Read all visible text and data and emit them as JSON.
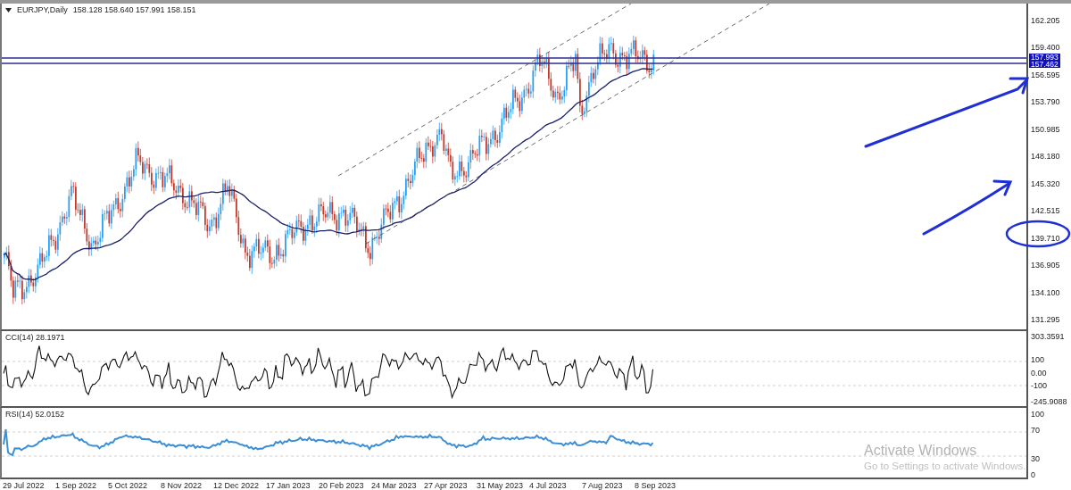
{
  "main_chart": {
    "symbol": "EURJPY,Daily",
    "ohlc": "158.128 158.640 157.991 158.151",
    "price_axis": [
      "162.205",
      "159.400",
      "156.595",
      "153.790",
      "150.985",
      "148.180",
      "145.320",
      "142.515",
      "139.710",
      "136.905",
      "134.100",
      "131.295"
    ],
    "price_lines": [
      {
        "label": "157.993"
      },
      {
        "label": "157.462"
      }
    ]
  },
  "cci": {
    "title": "CCI(14) 28.1971",
    "axis": [
      "303.3591",
      "100",
      "0.00",
      "-100",
      "-245.9088"
    ]
  },
  "rsi": {
    "title": "RSI(14) 52.0152",
    "axis": [
      "100",
      "70",
      "30",
      "0"
    ]
  },
  "time_axis": [
    "29 Jul 2022",
    "1 Sep 2022",
    "5 Oct 2022",
    "8 Nov 2022",
    "12 Dec 2022",
    "17 Jan 2023",
    "20 Feb 2023",
    "24 Mar 2023",
    "27 Apr 2023",
    "31 May 2023",
    "4 Jul 2023",
    "7 Aug 2023",
    "8 Sep 2023"
  ],
  "os_notice": {
    "title": "Activate Windows",
    "text": "Go to Settings to activate Windows."
  }
}
